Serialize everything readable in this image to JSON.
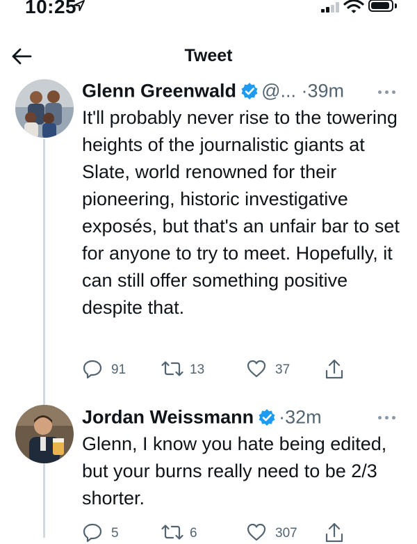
{
  "status_bar": {
    "time": "10:25",
    "icons": [
      "location-arrow-icon",
      "cellular-signal-icon",
      "wifi-icon",
      "battery-icon"
    ]
  },
  "header": {
    "title": "Tweet",
    "back_icon": "arrow-left-icon"
  },
  "tweets": [
    {
      "author": "Glenn Greenwald",
      "handle": "@...",
      "separator": "·",
      "time": "39m",
      "verified": true,
      "text": "It'll probably never rise to the towering heights of the journalistic giants at Slate, world renowned for their pioneering, historic investigative exposés, but that's an unfair bar to set for anyone to try to meet. Hopefully, it can still offer something positive despite that.",
      "replies": "91",
      "retweets": "13",
      "likes": "37"
    },
    {
      "author": "Jordan Weissmann",
      "separator": "·",
      "time": "32m",
      "verified": true,
      "text": "Glenn, I know you hate being edited, but your burns really need to be 2/3 shorter.",
      "replies": "5",
      "retweets": "6",
      "likes": "307"
    }
  ],
  "colors": {
    "text": "#0f1419",
    "secondary": "#536471",
    "verified": "#1d9bf0",
    "thread_line": "#cfd9de"
  }
}
